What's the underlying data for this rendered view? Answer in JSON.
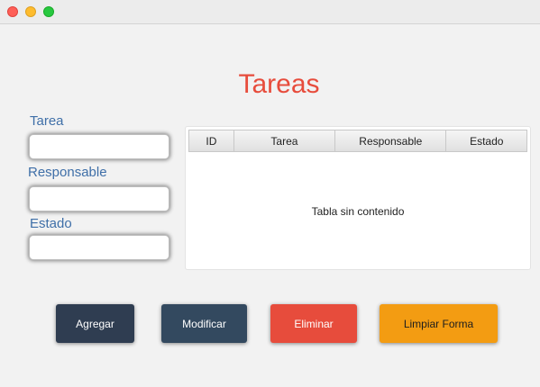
{
  "window": {
    "title": ""
  },
  "colors": {
    "title": "#e74c3c",
    "label": "#3f6fa8",
    "btn_agregar": "#2f3d51",
    "btn_modificar": "#33495f",
    "btn_eliminar": "#e74c3c",
    "btn_limpiar": "#f39c12"
  },
  "page": {
    "title": "Tareas"
  },
  "form": {
    "fields": [
      {
        "label": "Tarea",
        "value": ""
      },
      {
        "label": "Responsable",
        "value": ""
      },
      {
        "label": "Estado",
        "value": ""
      }
    ]
  },
  "table": {
    "columns": [
      "ID",
      "Tarea",
      "Responsable",
      "Estado"
    ],
    "rows": [],
    "empty_message": "Tabla sin contenido"
  },
  "buttons": {
    "agregar": "Agregar",
    "modificar": "Modificar",
    "eliminar": "Eliminar",
    "limpiar": "Limpiar Forma"
  }
}
